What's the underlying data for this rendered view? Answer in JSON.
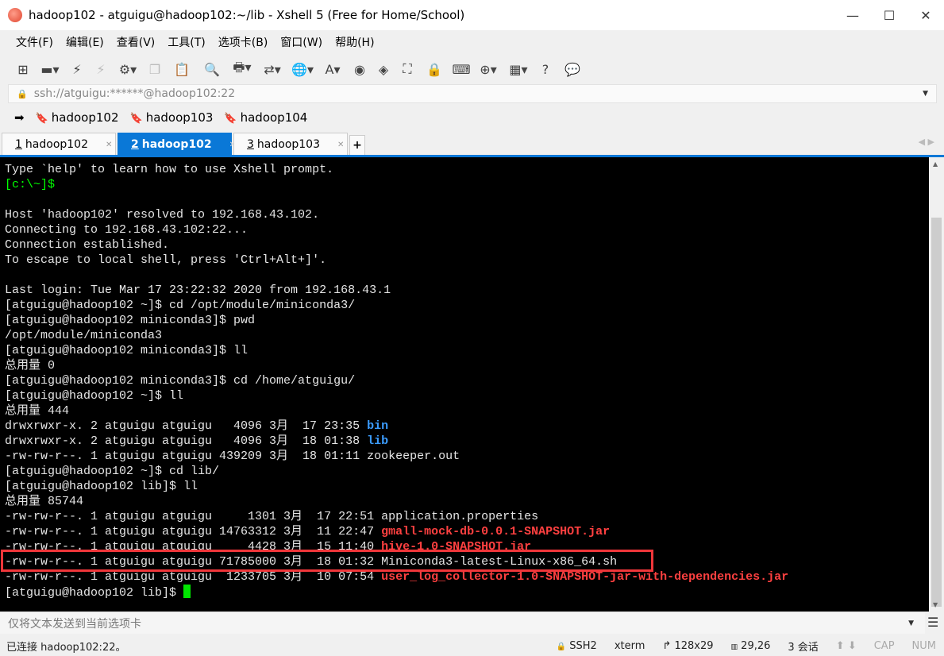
{
  "window": {
    "title": "hadoop102 - atguigu@hadoop102:~/lib - Xshell 5 (Free for Home/School)",
    "minimize": "—",
    "maximize": "☐",
    "close": "✕"
  },
  "menu": [
    "文件(F)",
    "编辑(E)",
    "查看(V)",
    "工具(T)",
    "选项卡(B)",
    "窗口(W)",
    "帮助(H)"
  ],
  "toolbar": [
    {
      "icon": "new-session-icon",
      "glyph": "⊞"
    },
    {
      "icon": "open-folder-icon",
      "glyph": "▬▾"
    },
    {
      "icon": "connect-icon",
      "glyph": "⚡"
    },
    {
      "icon": "disconnect-icon",
      "glyph": "⚡",
      "disabled": true
    },
    {
      "icon": "properties-icon",
      "glyph": "⚙▾"
    },
    {
      "icon": "copy-icon",
      "glyph": "❐",
      "disabled": true
    },
    {
      "icon": "paste-icon",
      "glyph": "📋"
    },
    {
      "icon": "find-icon",
      "glyph": "🔍"
    },
    {
      "icon": "print-icon",
      "glyph": "🖶▾"
    },
    {
      "icon": "transfer-icon",
      "glyph": "⇄▾"
    },
    {
      "icon": "globe-icon",
      "glyph": "🌐▾"
    },
    {
      "icon": "font-icon",
      "glyph": "A▾"
    },
    {
      "icon": "xshell-icon",
      "glyph": "◉"
    },
    {
      "icon": "xftp-icon",
      "glyph": "◈"
    },
    {
      "icon": "fullscreen-icon",
      "glyph": "⛶"
    },
    {
      "icon": "lock-icon",
      "glyph": "🔒"
    },
    {
      "icon": "keyboard-icon",
      "glyph": "⌨"
    },
    {
      "icon": "add-tab-icon",
      "glyph": "⊕▾"
    },
    {
      "icon": "layout-icon",
      "glyph": "▦▾"
    },
    {
      "icon": "help-icon",
      "glyph": "?"
    },
    {
      "icon": "chat-icon",
      "glyph": "💬"
    }
  ],
  "address": {
    "value": "ssh://atguigu:******@hadoop102:22"
  },
  "links": [
    "hadoop102",
    "hadoop103",
    "hadoop104"
  ],
  "tabs": [
    {
      "num": "1",
      "label": "hadoop102",
      "active": false
    },
    {
      "num": "2",
      "label": "hadoop102",
      "active": true
    },
    {
      "num": "3",
      "label": "hadoop103",
      "active": false
    }
  ],
  "colors": {
    "prompt": "#00ff00",
    "dir": "#3b9cff",
    "jar": "#ff4040",
    "text": "#e5e5e5",
    "highlight": "#f0363a",
    "tab_active": "#0a78d7"
  },
  "terminal": [
    [
      {
        "t": "Type `help' to learn how to use Xshell prompt."
      }
    ],
    [
      {
        "t": "[c:\\~]$",
        "c": "prompt"
      }
    ],
    [
      {
        "t": ""
      }
    ],
    [
      {
        "t": "Host 'hadoop102' resolved to 192.168.43.102."
      }
    ],
    [
      {
        "t": "Connecting to 192.168.43.102:22..."
      }
    ],
    [
      {
        "t": "Connection established."
      }
    ],
    [
      {
        "t": "To escape to local shell, press 'Ctrl+Alt+]'."
      }
    ],
    [
      {
        "t": ""
      }
    ],
    [
      {
        "t": "Last login: Tue Mar 17 23:22:32 2020 from 192.168.43.1"
      }
    ],
    [
      {
        "t": "[atguigu@hadoop102 ~]$ cd /opt/module/miniconda3/"
      }
    ],
    [
      {
        "t": "[atguigu@hadoop102 miniconda3]$ pwd"
      }
    ],
    [
      {
        "t": "/opt/module/miniconda3"
      }
    ],
    [
      {
        "t": "[atguigu@hadoop102 miniconda3]$ ll"
      }
    ],
    [
      {
        "t": "总用量 0"
      }
    ],
    [
      {
        "t": "[atguigu@hadoop102 miniconda3]$ cd /home/atguigu/"
      }
    ],
    [
      {
        "t": "[atguigu@hadoop102 ~]$ ll"
      }
    ],
    [
      {
        "t": "总用量 444"
      }
    ],
    [
      {
        "t": "drwxrwxr-x. 2 atguigu atguigu   4096 3月  17 23:35 "
      },
      {
        "t": "bin",
        "c": "dir"
      }
    ],
    [
      {
        "t": "drwxrwxr-x. 2 atguigu atguigu   4096 3月  18 01:38 "
      },
      {
        "t": "lib",
        "c": "dir"
      }
    ],
    [
      {
        "t": "-rw-rw-r--. 1 atguigu atguigu 439209 3月  18 01:11 zookeeper.out"
      }
    ],
    [
      {
        "t": "[atguigu@hadoop102 ~]$ cd lib/"
      }
    ],
    [
      {
        "t": "[atguigu@hadoop102 lib]$ ll"
      }
    ],
    [
      {
        "t": "总用量 85744"
      }
    ],
    [
      {
        "t": "-rw-rw-r--. 1 atguigu atguigu     1301 3月  17 22:51 application.properties"
      }
    ],
    [
      {
        "t": "-rw-rw-r--. 1 atguigu atguigu 14763312 3月  11 22:47 "
      },
      {
        "t": "gmall-mock-db-0.0.1-SNAPSHOT.jar",
        "c": "jar"
      }
    ],
    [
      {
        "t": "-rw-rw-r--. 1 atguigu atguigu     4428 3月  15 11:40 "
      },
      {
        "t": "hive-1.0-SNAPSHOT.jar",
        "c": "jar"
      }
    ],
    [
      {
        "t": "-rw-rw-r--. 1 atguigu atguigu 71785000 3月  18 01:32 Miniconda3-latest-Linux-x86_64.sh"
      }
    ],
    [
      {
        "t": "-rw-rw-r--. 1 atguigu atguigu  1233705 3月  10 07:54 "
      },
      {
        "t": "user_log_collector-1.0-SNAPSHOT-jar-with-dependencies.jar",
        "c": "jar"
      }
    ],
    [
      {
        "t": "[atguigu@hadoop102 lib]$ "
      }
    ]
  ],
  "compose": {
    "placeholder": "仅将文本发送到当前选项卡"
  },
  "status": {
    "connection": "已连接 hadoop102:22。",
    "protocol": "SSH2",
    "term": "xterm",
    "size": "128x29",
    "cursor_pos": "29,26",
    "sessions": "3 会话",
    "cap": "CAP",
    "num": "NUM"
  }
}
